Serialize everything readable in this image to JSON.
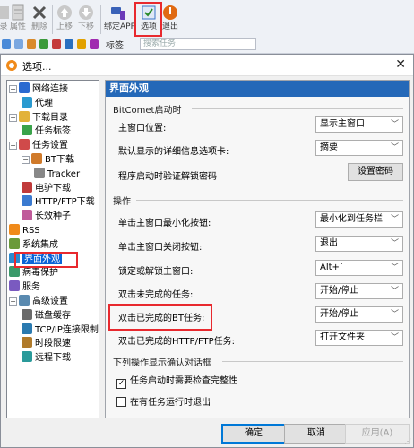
{
  "toolbar": {
    "buttons": [
      {
        "label": "录",
        "icon": "record-icon",
        "disabled": true
      },
      {
        "label": "属性",
        "icon": "properties-icon",
        "disabled": true
      },
      {
        "label": "删除",
        "icon": "delete-icon",
        "disabled": true
      },
      {
        "label": "上移",
        "icon": "move-up-icon",
        "disabled": true
      },
      {
        "label": "下移",
        "icon": "move-down-icon",
        "disabled": true
      },
      {
        "label": "绑定APP",
        "icon": "bind-app-icon",
        "disabled": false
      },
      {
        "label": "选项",
        "icon": "options-icon",
        "disabled": false
      },
      {
        "label": "退出",
        "icon": "exit-icon",
        "disabled": false
      }
    ],
    "tag_label": "标签",
    "search_placeholder": "搜索任务"
  },
  "dialog": {
    "title": "选项...",
    "close_glyph": "✕",
    "tree": [
      {
        "label": "网络连接",
        "icon": "network-icon",
        "level": 0,
        "toggle": "−"
      },
      {
        "label": "代理",
        "icon": "proxy-icon",
        "level": 1
      },
      {
        "label": "下载目录",
        "icon": "folder-icon",
        "level": 0,
        "toggle": "−"
      },
      {
        "label": "任务标签",
        "icon": "tag-icon",
        "level": 1
      },
      {
        "label": "任务设置",
        "icon": "task-settings-icon",
        "level": 0,
        "toggle": "−"
      },
      {
        "label": "BT下载",
        "icon": "bt-icon",
        "level": 1,
        "toggle": "−"
      },
      {
        "label": "Tracker",
        "icon": "tracker-icon",
        "level": 2
      },
      {
        "label": "电驴下载",
        "icon": "ed2k-icon",
        "level": 1
      },
      {
        "label": "HTTP/FTP下载",
        "icon": "http-ftp-icon",
        "level": 1
      },
      {
        "label": "长效种子",
        "icon": "long-seed-icon",
        "level": 1
      },
      {
        "label": "RSS",
        "icon": "rss-icon",
        "level": 0
      },
      {
        "label": "系统集成",
        "icon": "system-integration-icon",
        "level": 0
      },
      {
        "label": "界面外观",
        "icon": "appearance-icon",
        "level": 0,
        "selected": true
      },
      {
        "label": "病毒保护",
        "icon": "virus-protection-icon",
        "level": 0
      },
      {
        "label": "服务",
        "icon": "service-icon",
        "level": 0
      },
      {
        "label": "高级设置",
        "icon": "advanced-icon",
        "level": 0,
        "toggle": "−"
      },
      {
        "label": "磁盘缓存",
        "icon": "disk-cache-icon",
        "level": 1
      },
      {
        "label": "TCP/IP连接限制",
        "icon": "tcpip-icon",
        "level": 1
      },
      {
        "label": "时段限速",
        "icon": "schedule-icon",
        "level": 1
      },
      {
        "label": "远程下载",
        "icon": "remote-download-icon",
        "level": 1
      }
    ],
    "panel": {
      "header": "界面外观",
      "group_startup": "BitComet启动时",
      "main_window_position_label": "主窗口位置:",
      "main_window_position_value": "显示主窗口",
      "default_tab_label": "默认显示的详细信息选项卡:",
      "default_tab_value": "摘要",
      "password_label": "程序启动时验证解锁密码",
      "password_button": "设置密码",
      "group_actions": "操作",
      "minimize_label": "单击主窗口最小化按钮:",
      "minimize_value": "最小化到任务栏",
      "close_label": "单击主窗口关闭按钮:",
      "close_value": "退出",
      "lock_label": "锁定或解锁主窗口:",
      "lock_value": "Alt+`",
      "dbl_unfinished_label": "双击未完成的任务:",
      "dbl_unfinished_value": "开始/停止",
      "dbl_bt_label": "双击已完成的BT任务:",
      "dbl_bt_value": "开始/停止",
      "dbl_http_label": "双击已完成的HTTP/FTP任务:",
      "dbl_http_value": "打开文件夹",
      "group_confirm": "下列操作显示确认对话框",
      "confirm_integrity_label": "任务启动时需要检查完整性",
      "confirm_integrity_checked": true,
      "confirm_exit_label": "在有任务运行时退出",
      "confirm_exit_checked": false
    },
    "buttons": {
      "ok": "确定",
      "cancel": "取消",
      "apply": "应用(A)"
    }
  },
  "colors": {
    "accent": "#2468b8",
    "selection": "#0a64d8",
    "highlight": "#e8292e"
  }
}
